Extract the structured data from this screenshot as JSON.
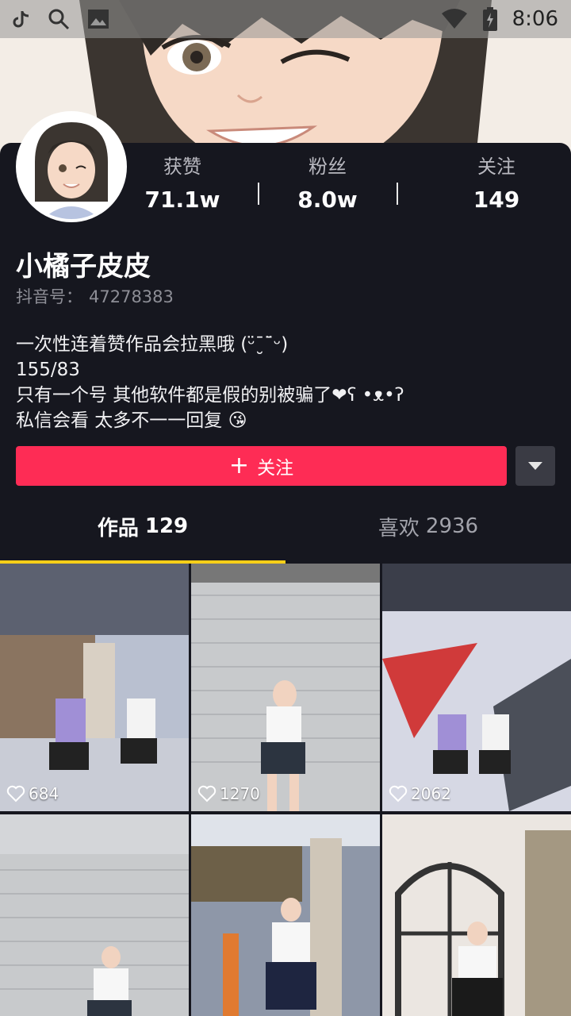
{
  "statusbar": {
    "time": "8:06"
  },
  "profile": {
    "name": "小橘子皮皮",
    "uid_label": "抖音号：",
    "uid_value": "47278383",
    "stats": [
      {
        "label": "获赞",
        "value": "71.1w"
      },
      {
        "label": "粉丝",
        "value": "8.0w"
      },
      {
        "label": "关注",
        "value": "149"
      }
    ],
    "bio": [
      "一次性连着赞作品会拉黑哦 (ᵕ̈ˉ̮ˉ̈ᵕ)",
      "155/83",
      "只有一个号 其他软件都是假的别被骗了❤ʕ •ᴥ•ʔ",
      "私信会看 太多不一一回复 😘"
    ]
  },
  "actions": {
    "follow_label": "关注",
    "plus": "+"
  },
  "tabs": [
    {
      "label": "作品",
      "count": "129"
    },
    {
      "label": "喜欢",
      "count": "2936"
    }
  ],
  "videos": [
    {
      "likes": "684"
    },
    {
      "likes": "1270"
    },
    {
      "likes": "2062"
    },
    {
      "likes": ""
    },
    {
      "likes": ""
    },
    {
      "likes": ""
    }
  ],
  "colors": {
    "accent": "#fe2c55",
    "tab_indicator": "#facf18",
    "background": "#16171f"
  }
}
